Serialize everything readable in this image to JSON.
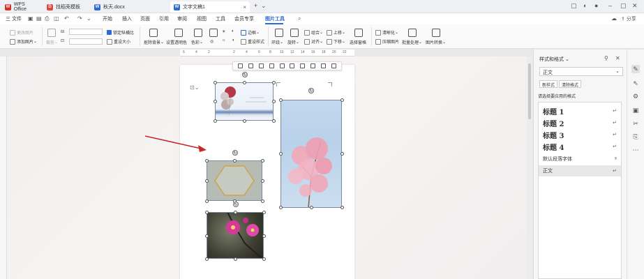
{
  "tabs": [
    {
      "label": "WPS Office",
      "icon": "wps-logo-icon",
      "color": "#d93025",
      "glyph": "W"
    },
    {
      "label": "找稻壳模板",
      "icon": "docer-icon",
      "color": "#e0463c",
      "glyph": "D"
    },
    {
      "label": "秋天.docx",
      "icon": "word-doc-icon",
      "color": "#2e69d8",
      "glyph": "W"
    },
    {
      "label": "文字文稿1",
      "icon": "word-doc-icon",
      "color": "#2e69d8",
      "glyph": "W"
    }
  ],
  "menu": {
    "file": "三 文件",
    "items": [
      "开始",
      "插入",
      "页面",
      "引用",
      "审阅",
      "视图",
      "工具",
      "会员专享",
      "图片工具"
    ],
    "active_index": 8,
    "share": "分享"
  },
  "ribbon": {
    "change_picture": "更改图片",
    "add_picture": "添加图片",
    "crop": "裁剪",
    "lock_ratio": "锁定纵横比",
    "reset_size": "重设大小",
    "remove_bg": "抠除背景",
    "set_transparent": "设置透明色",
    "color": "色彩",
    "border": "边框",
    "reset_style": "重设样式",
    "wrap": "环绕",
    "rotate": "旋转",
    "group": "组合",
    "align": "对齐",
    "bring_forward": "上移",
    "send_backward": "下移",
    "selection_pane": "选择窗格",
    "sharpen": "清晰化",
    "compress": "压缩图片",
    "batch": "批量处理",
    "convert": "图片转换"
  },
  "ruler": [
    "6",
    "4",
    "2",
    "2",
    "4",
    "6",
    "8",
    "10",
    "12",
    "14",
    "16",
    "18",
    "20",
    "22"
  ],
  "styles_pane": {
    "title": "样式和格式",
    "current_style": "正文",
    "new_style": "新样式",
    "clear_format": "清除格式",
    "apply_label": "请选择要应用的格式",
    "items": [
      {
        "label": "标题 1",
        "kind": "heading"
      },
      {
        "label": "标题 2",
        "kind": "heading"
      },
      {
        "label": "标题 3",
        "kind": "heading"
      },
      {
        "label": "标题 4",
        "kind": "heading"
      },
      {
        "label": "默认段落字体",
        "kind": "small"
      },
      {
        "label": "正文",
        "kind": "small"
      }
    ]
  },
  "colors": {
    "accent": "#2e69d8",
    "arrow": "#c62828"
  }
}
